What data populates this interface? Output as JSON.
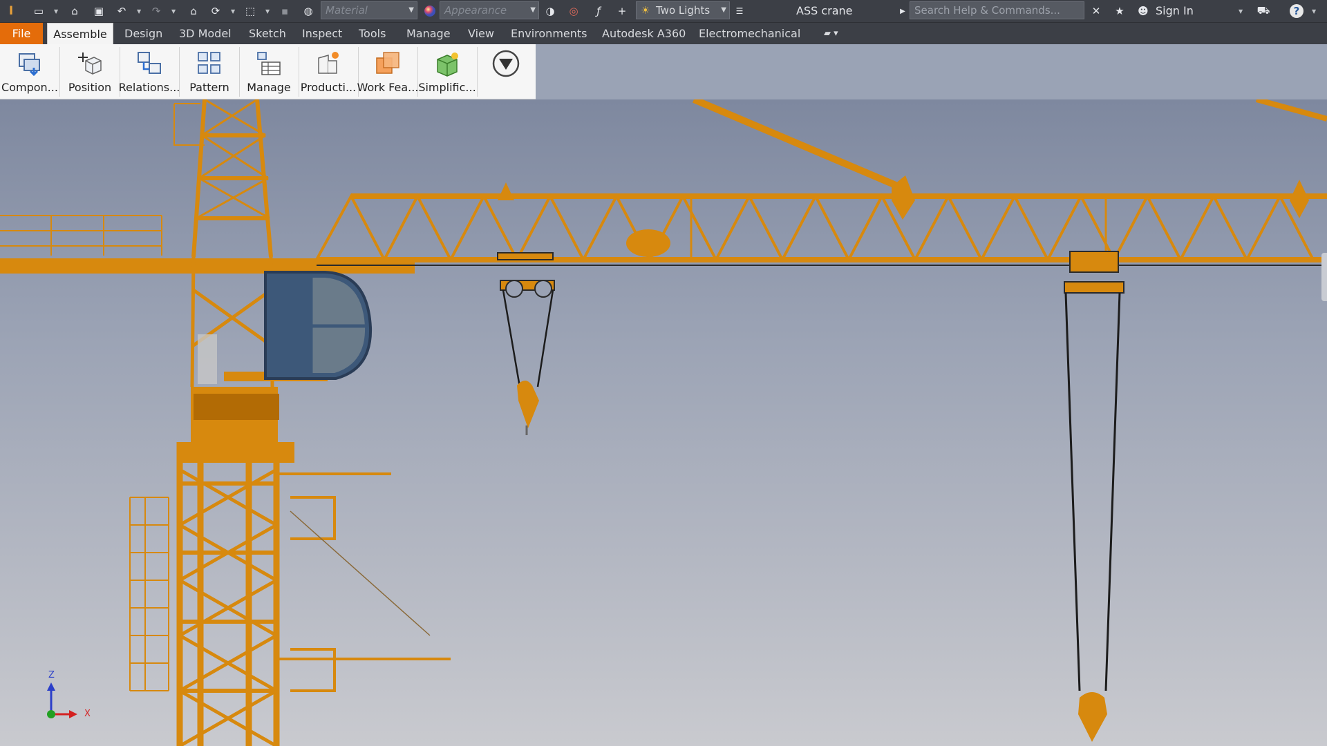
{
  "quick_access": {
    "material_placeholder": "Material",
    "appearance_placeholder": "Appearance",
    "lighting_style": "Two Lights",
    "document_title": "ASS crane",
    "search_placeholder": "Search Help & Commands...",
    "sign_in": "Sign In"
  },
  "tabs": [
    {
      "label": "File"
    },
    {
      "label": "Assemble"
    },
    {
      "label": "Design"
    },
    {
      "label": "3D Model"
    },
    {
      "label": "Sketch"
    },
    {
      "label": "Inspect"
    },
    {
      "label": "Tools"
    },
    {
      "label": "Manage"
    },
    {
      "label": "View"
    },
    {
      "label": "Environments"
    },
    {
      "label": "Autodesk A360"
    },
    {
      "label": "Electromechanical"
    }
  ],
  "ribbon": {
    "buttons": [
      {
        "label": "Compon..."
      },
      {
        "label": "Position"
      },
      {
        "label": "Relations..."
      },
      {
        "label": "Pattern"
      },
      {
        "label": "Manage"
      },
      {
        "label": "Producti..."
      },
      {
        "label": "Work Fea..."
      },
      {
        "label": "Simplific..."
      }
    ]
  },
  "axis_triad": {
    "z_label": "Z",
    "x_label": "X"
  },
  "colors": {
    "crane": "#d7890e",
    "crane_dark": "#b26b05",
    "cabin": "#3d5879",
    "file_tab": "#e46c0a",
    "ui_dark": "#3c3f46"
  }
}
